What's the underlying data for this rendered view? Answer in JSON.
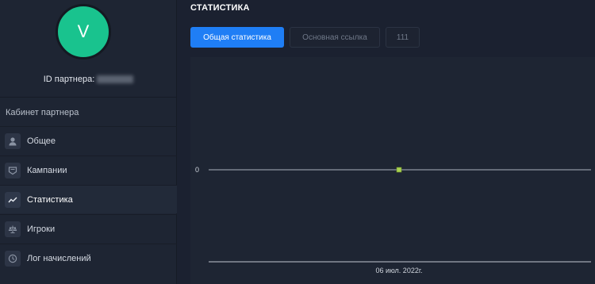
{
  "sidebar": {
    "avatar_letter": "V",
    "partner_label": "ID партнера:",
    "section_title": "Кабинет партнера",
    "items": [
      {
        "label": "Общее",
        "icon": "user-icon"
      },
      {
        "label": "Кампании",
        "icon": "campaign-icon"
      },
      {
        "label": "Статистика",
        "icon": "stats-icon",
        "active": true
      },
      {
        "label": "Игроки",
        "icon": "players-icon"
      },
      {
        "label": "Лог начислений",
        "icon": "clock-icon"
      }
    ]
  },
  "main": {
    "title": "СТАТИСТИКА",
    "tabs": [
      {
        "label": "Общая статистика",
        "active": true
      },
      {
        "label": "Основная ссылка"
      },
      {
        "label": "111"
      }
    ]
  },
  "colors": {
    "accent": "#1f7ef5",
    "avatar": "#19c38e",
    "point": "#a8d34f",
    "background": "#1b2130",
    "panel": "#1e2533"
  },
  "chart_data": {
    "type": "line",
    "x": [
      "06 июл. 2022г."
    ],
    "series": [
      {
        "values": [
          0
        ]
      }
    ],
    "ytick_labels": [
      "0"
    ],
    "xtick_labels": [
      "06 июл. 2022г."
    ],
    "grid": false
  }
}
